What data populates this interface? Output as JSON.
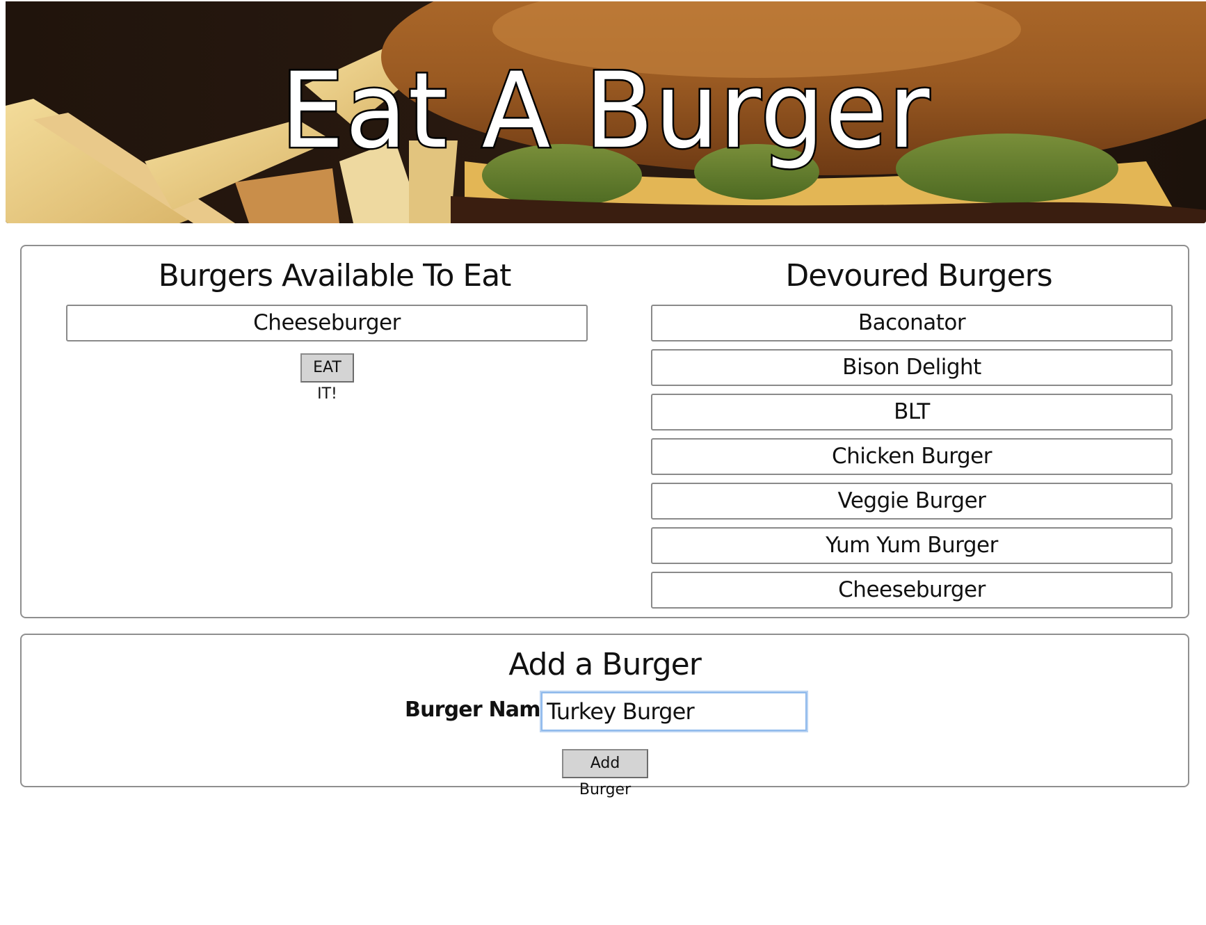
{
  "header": {
    "title": "Eat A Burger"
  },
  "available": {
    "heading": "Burgers Available To Eat",
    "items": [
      {
        "name": "Cheeseburger",
        "button_label": "EAT IT!"
      }
    ]
  },
  "devoured": {
    "heading": "Devoured Burgers",
    "items": [
      "Baconator",
      "Bison Delight",
      "BLT",
      "Chicken Burger",
      "Veggie Burger",
      "Yum Yum Burger",
      "Cheeseburger"
    ]
  },
  "add_form": {
    "heading": "Add a Burger",
    "label": "Burger Name:",
    "input_value": "Turkey Burger",
    "submit_label": "Add Burger"
  },
  "colors": {
    "panel_border": "#8f8f8f",
    "button_bg": "#d4d4d4",
    "input_focus": "#8eb9ec"
  }
}
